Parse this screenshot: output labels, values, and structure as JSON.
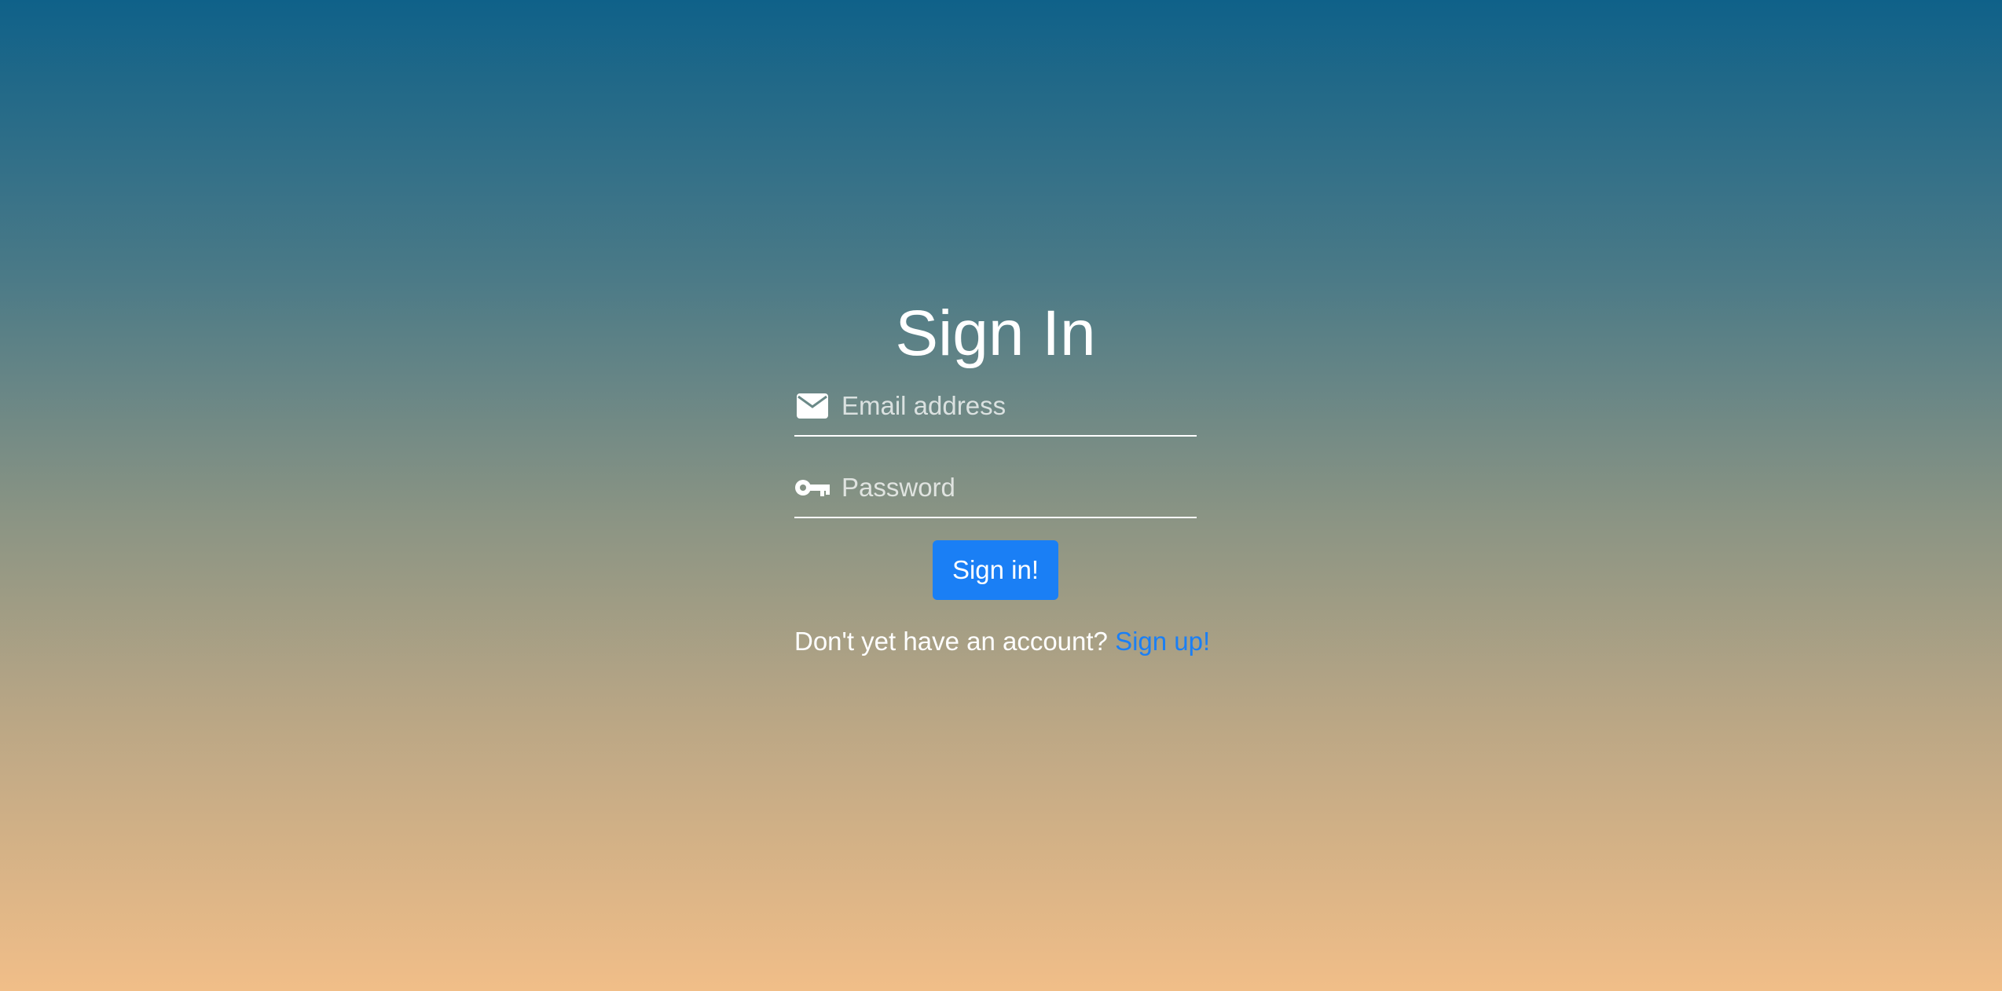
{
  "page": {
    "title": "Sign In"
  },
  "form": {
    "email": {
      "placeholder": "Email address",
      "value": "",
      "icon": "envelope-icon"
    },
    "password": {
      "placeholder": "Password",
      "value": "",
      "icon": "key-icon"
    },
    "submit_label": "Sign in!",
    "signup_prompt": "Don't yet have an account?",
    "signup_link_label": "Sign up!"
  },
  "colors": {
    "accent": "#1a7ff5",
    "gradient_top": "#0f6189",
    "gradient_bottom": "#f1be88",
    "text": "#ffffff"
  }
}
